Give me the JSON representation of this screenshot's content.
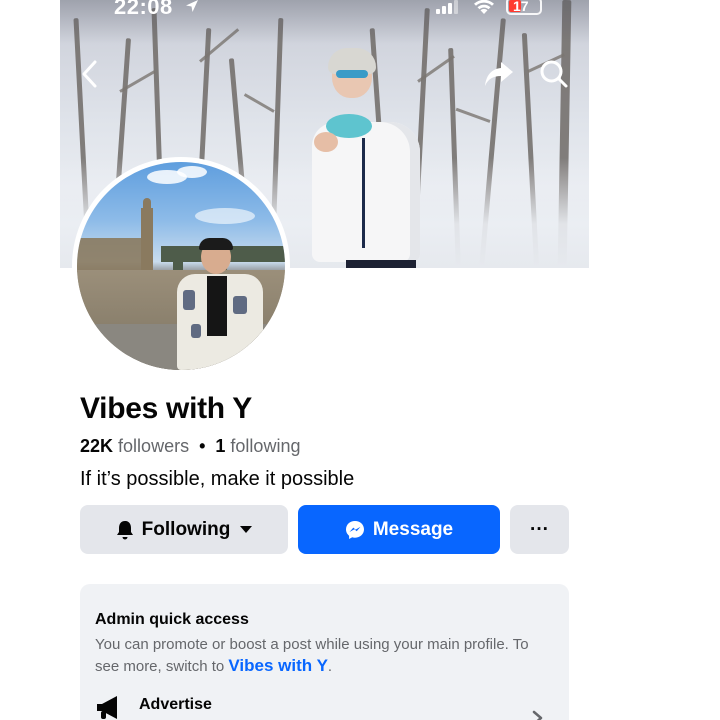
{
  "status_bar": {
    "time": "22:08",
    "battery_level": "17",
    "icons": [
      "location-arrow-icon",
      "signal-icon",
      "wifi-icon",
      "battery-icon"
    ]
  },
  "nav": {
    "icons": [
      "chevron-left-icon",
      "share-arrow-icon",
      "search-icon"
    ]
  },
  "profile": {
    "name": "Vibes with Y",
    "followers_count": "22K",
    "followers_label": "followers",
    "following_count": "1",
    "following_label": "following",
    "separator": "•",
    "bio": "If it’s possible, make it possible"
  },
  "actions": {
    "following_label": "Following",
    "message_label": "Message",
    "more_label": "···"
  },
  "admin_card": {
    "title": "Admin quick access",
    "description": "You can promote or boost a post while using your main profile. To see more, switch to",
    "link_text": "Vibes with Y",
    "period": ".",
    "advertise_label": "Advertise"
  },
  "colors": {
    "accent": "#0866ff",
    "button_gray": "#e4e6eb",
    "card_bg": "#f0f2f5",
    "secondary_text": "#65676b",
    "battery_low": "#ff3b30"
  }
}
